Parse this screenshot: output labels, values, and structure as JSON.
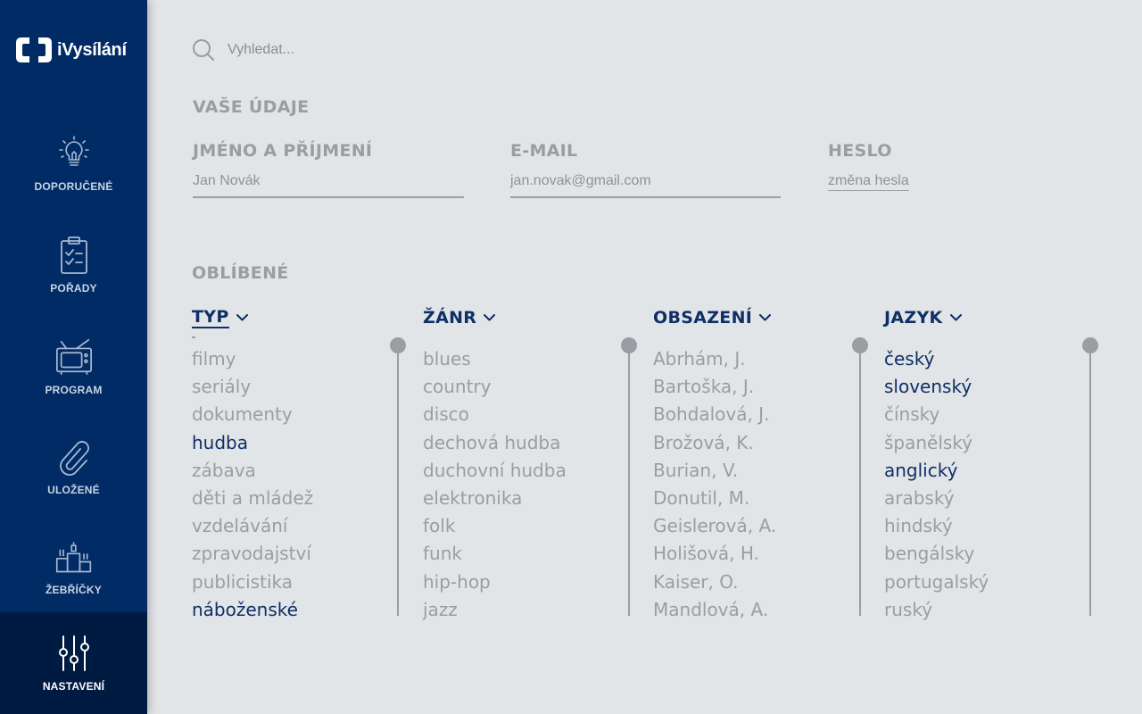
{
  "app": {
    "logo_text": "iVysílání"
  },
  "nav": [
    {
      "label": "DOPORUČENÉ",
      "icon": "lightbulb-icon"
    },
    {
      "label": "POŘADY",
      "icon": "clipboard-check-icon"
    },
    {
      "label": "PROGRAM",
      "icon": "tv-icon"
    },
    {
      "label": "ULOŽENÉ",
      "icon": "paperclip-icon"
    },
    {
      "label": "ŽEBŘÍČKY",
      "icon": "podium-icon"
    },
    {
      "label": "NASTAVENÍ",
      "icon": "sliders-icon",
      "active": true
    }
  ],
  "search": {
    "placeholder": "Vyhledat..."
  },
  "profile": {
    "title": "VAŠE ÚDAJE",
    "name_label": "JMÉNO A PŘÍJMENÍ",
    "name_value": "Jan Novák",
    "email_label": "E-MAIL",
    "email_value": "jan.novak@gmail.com",
    "password_label": "HESLO",
    "password_link": "změna hesla"
  },
  "favorites": {
    "title": "OBLÍBENÉ",
    "columns": [
      {
        "label": "TYP",
        "items": [
          "filmy",
          "seriály",
          "dokumenty",
          "hudba",
          "zábava",
          "děti a mládež",
          "vzdelávání",
          "zpravodajství",
          "publicistika",
          "náboženské"
        ],
        "selected": [
          "hudba",
          "náboženské"
        ]
      },
      {
        "label": "ŽÁNR",
        "items": [
          "blues",
          "country",
          "disco",
          "dechová hudba",
          "duchovní hudba",
          "elektronika",
          "folk",
          "funk",
          "hip-hop",
          "jazz"
        ],
        "selected": []
      },
      {
        "label": "OBSAZENÍ",
        "items": [
          "Abrhám, J.",
          "Bartoška, J.",
          "Bohdalová, J.",
          "Brožová, K.",
          "Burian, V.",
          "Donutil, M.",
          "Geislerová, A.",
          "Holišová, H.",
          "Kaiser, O.",
          "Mandlová, A."
        ],
        "selected": []
      },
      {
        "label": "JAZYK",
        "items": [
          "český",
          "slovenský",
          "čínsky",
          "španělský",
          "anglický",
          "arabský",
          "hindský",
          "bengálsky",
          "portugalský",
          "ruský"
        ],
        "selected": [
          "český",
          "slovenský",
          "anglický"
        ]
      }
    ]
  },
  "colors": {
    "sidebar": "#002b65",
    "sidebar_active": "#001b41",
    "accent": "#0f2f66",
    "muted": "#9a9da1",
    "background": "#e2e5e8"
  }
}
